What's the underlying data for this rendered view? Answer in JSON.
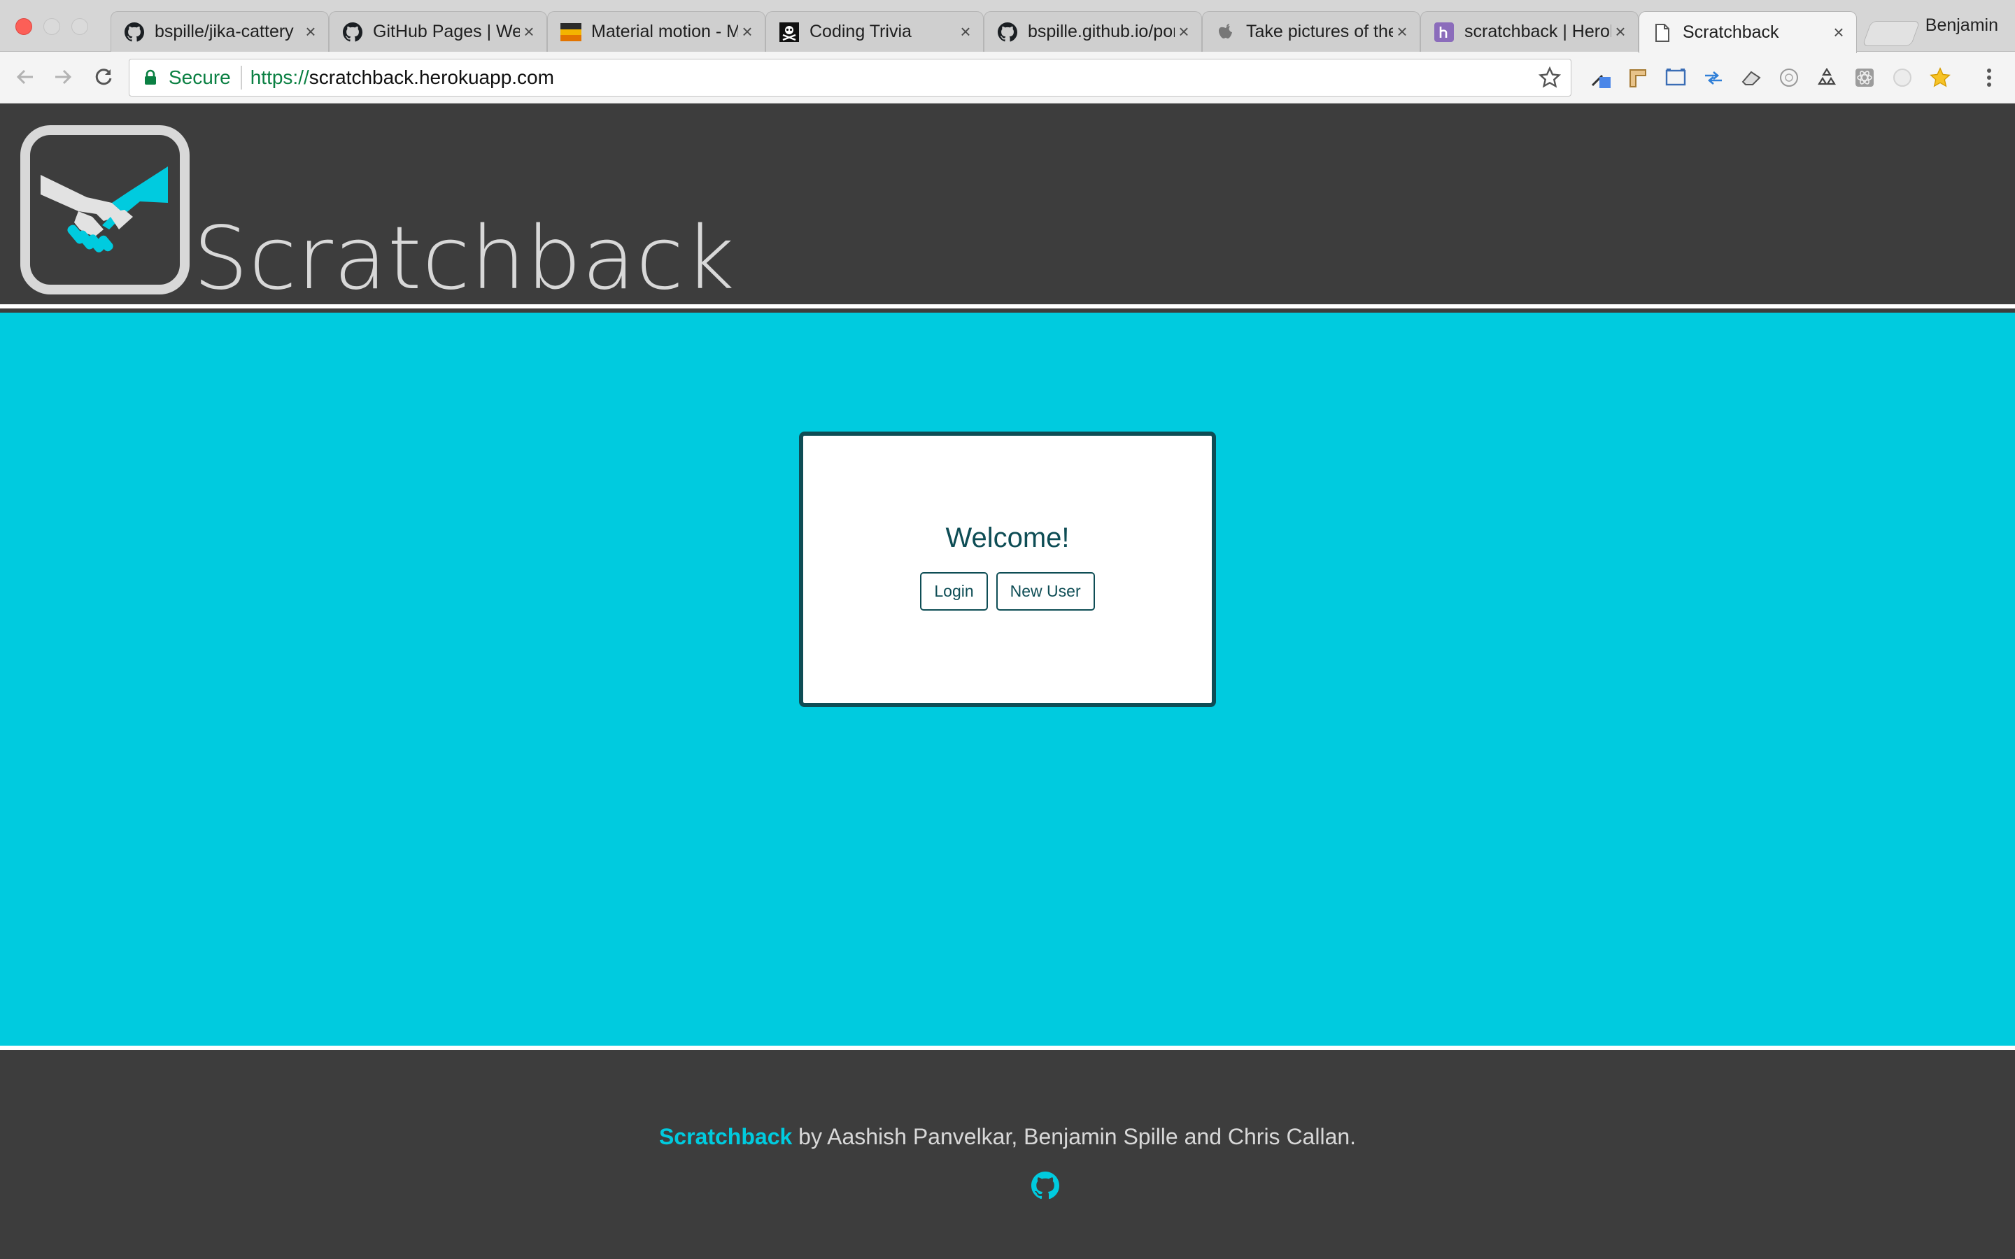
{
  "browser": {
    "tabs": [
      {
        "title": "bspille/jika-cattery",
        "icon": "github-icon"
      },
      {
        "title": "GitHub Pages | Websites",
        "icon": "github-icon"
      },
      {
        "title": "Material motion - Motion",
        "icon": "material-icon"
      },
      {
        "title": "Coding Trivia",
        "icon": "skull-icon"
      },
      {
        "title": "bspille.github.io/portfolio",
        "icon": "github-icon"
      },
      {
        "title": "Take pictures of the",
        "icon": "apple-icon"
      },
      {
        "title": "scratchback | Heroku",
        "icon": "heroku-icon"
      },
      {
        "title": "Scratchback",
        "icon": "page-icon",
        "active": true
      }
    ],
    "close_glyph": "×",
    "profile_name": "Benjamin",
    "security_label": "Secure",
    "url_scheme": "https://",
    "url_host": "scratchback.herokuapp.com"
  },
  "site": {
    "brand": "Scratchback",
    "card_title": "Welcome!",
    "login_label": "Login",
    "new_user_label": "New User",
    "footer_brand": "Scratchback",
    "footer_text": " by Aashish Panvelkar, Benjamin Spille and Chris Callan."
  },
  "colors": {
    "header_bg": "#3d3d3d",
    "accent": "#00cbdf",
    "dark_teal": "#0e4d55",
    "text_light": "#d8d8d8"
  }
}
